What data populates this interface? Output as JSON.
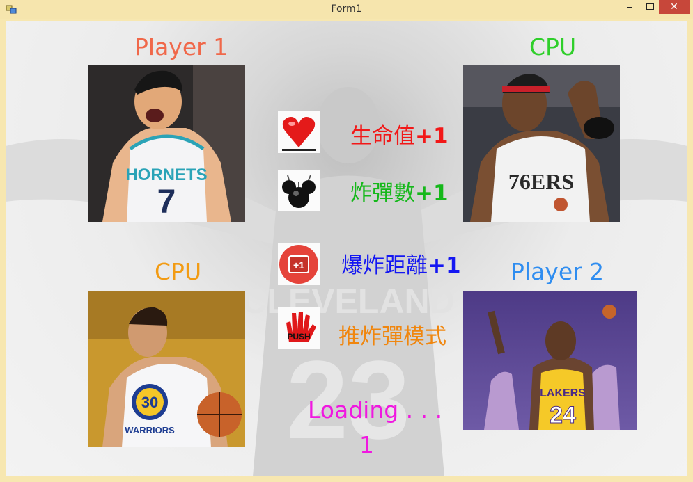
{
  "window": {
    "title": "Form1",
    "close_glyph": "✕"
  },
  "players": {
    "top_left": "Player 1",
    "top_right": "CPU",
    "bottom_left": "CPU",
    "bottom_right": "Player 2"
  },
  "photos": {
    "top_left_jersey": "HORNETS",
    "top_left_number": "7",
    "top_right_jersey": "76ERS",
    "bottom_left_jersey": "WARRIORS",
    "bottom_left_number": "30",
    "bottom_right_jersey": "LAKERS",
    "bottom_right_number": "24"
  },
  "background": {
    "jersey_text": "CLEVELAND",
    "jersey_number": "23"
  },
  "items": [
    {
      "icon": "heart-icon",
      "text": "生命值",
      "bonus": "+1"
    },
    {
      "icon": "bomb-icon",
      "text": "炸彈數",
      "bonus": "+1"
    },
    {
      "icon": "plus-one-icon",
      "icon_text": "+1",
      "text": "爆炸距離",
      "bonus": "+1"
    },
    {
      "icon": "push-hand-icon",
      "icon_text": "PUSH",
      "text": "推炸彈模式",
      "bonus": ""
    }
  ],
  "loading": {
    "text": "Loading . . .",
    "count": "1"
  },
  "colors": {
    "player1": "#f0684a",
    "cpu_top": "#2fcf2a",
    "cpu_bottom": "#f29b13",
    "player2": "#2f8df0",
    "life": "#f21818",
    "bombs": "#15b81a",
    "range": "#1417f2",
    "push": "#f0860e",
    "loading": "#f018e0"
  }
}
